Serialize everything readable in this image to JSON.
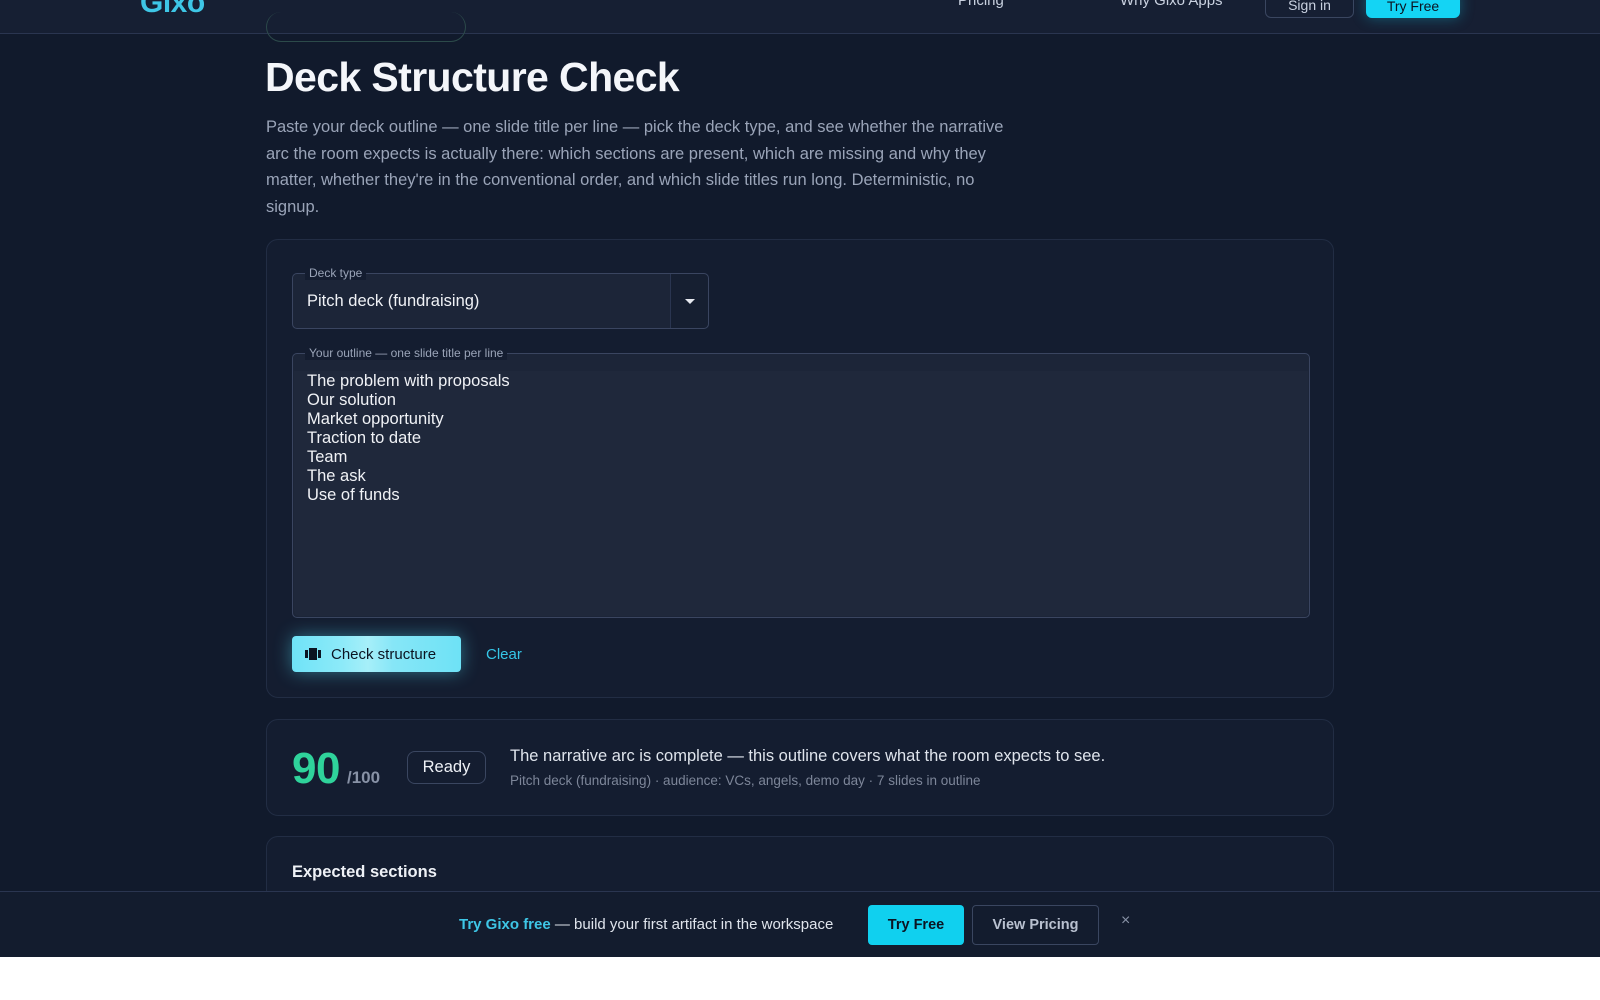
{
  "nav": {
    "logo": "Gixo",
    "links": [
      "Pricing",
      "Why Gixo Apps"
    ],
    "sign_in": "Sign in",
    "try_free": "Try Free"
  },
  "header": {
    "title": "Deck Structure Check",
    "description": "Paste your deck outline — one slide title per line — pick the deck type, and see whether the narrative arc the room expects is actually there: which sections are present, which are missing and why they matter, whether they're in the conventional order, and which slide titles run long. Deterministic, no signup."
  },
  "form": {
    "deck_type_label": "Deck type",
    "deck_type_value": "Pitch deck (fundraising)",
    "outline_label": "Your outline — one slide title per line",
    "outline_lines": [
      "The problem with proposals",
      "Our solution",
      "Market opportunity",
      "Traction to date",
      "Team",
      "The ask",
      "Use of funds"
    ],
    "check_button": "Check structure",
    "clear_button": "Clear"
  },
  "result": {
    "score": "90",
    "score_max": "/100",
    "status": "Ready",
    "verdict": "The narrative arc is complete — this outline covers what the room expects to see.",
    "meta": "Pitch deck (fundraising) · audience: VCs, angels, demo day · 7 slides in outline",
    "score_color": "#2fd39b"
  },
  "sections": {
    "title": "Expected sections"
  },
  "banner": {
    "highlight": "Try Gixo free",
    "text": " — build your first artifact in the workspace",
    "try_button": "Try Free",
    "pricing_button": "View Pricing",
    "close_glyph": "×"
  },
  "colors": {
    "accent": "#14d4f4",
    "background": "#111a2c",
    "card": "#141d30"
  }
}
